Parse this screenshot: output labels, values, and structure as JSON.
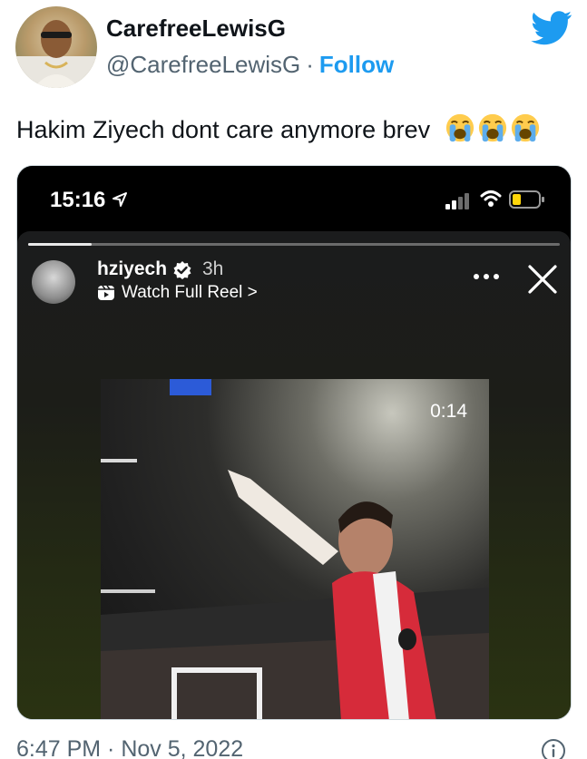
{
  "author": {
    "display_name": "CarefreeLewisG",
    "handle": "@CarefreeLewisG",
    "separator": "·",
    "follow_label": "Follow"
  },
  "tweet": {
    "text": "Hakim Ziyech dont care anymore brev",
    "emoji_count": 3,
    "emoji": "loudly-crying-face"
  },
  "phone_status": {
    "time": "15:16"
  },
  "story": {
    "username": "hziyech",
    "posted": "3h",
    "reel_link": "Watch Full Reel >",
    "progress": 0.12,
    "video_timestamp": "0:14"
  },
  "footer": {
    "timestamp": "6:47 PM · Nov 5, 2022"
  },
  "colors": {
    "twitter_blue": "#1d9bf0",
    "text_primary": "#0f1419",
    "text_secondary": "#536471"
  }
}
